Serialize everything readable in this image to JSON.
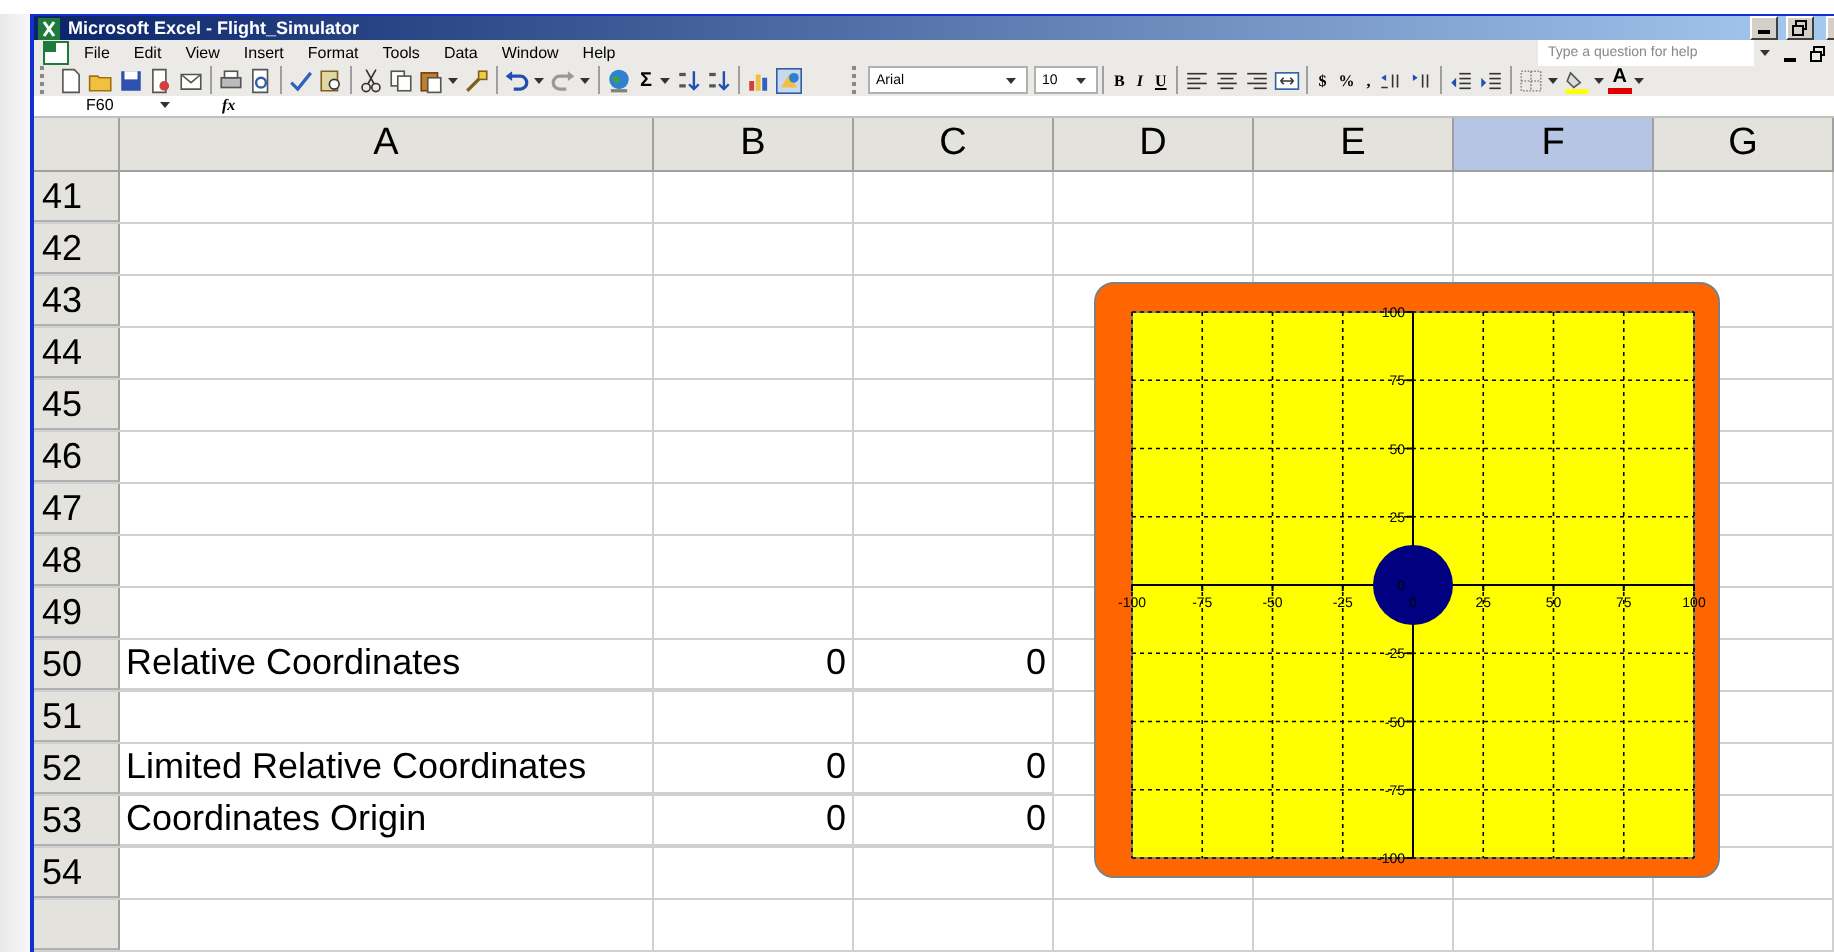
{
  "window": {
    "title": "Microsoft Excel - Flight_Simulator"
  },
  "menu_bar": {
    "items": [
      "File",
      "Edit",
      "View",
      "Insert",
      "Format",
      "Tools",
      "Data",
      "Window",
      "Help"
    ],
    "help_search": {
      "placeholder": "Type a question for help"
    }
  },
  "standard_toolbar": {
    "sum_button": "Σ"
  },
  "formatting_toolbar": {
    "font": "Arial",
    "size": "10",
    "style_buttons": [
      "B",
      "I",
      "U"
    ],
    "number_buttons": [
      "$",
      "%",
      ","
    ],
    "font_color_button": "A"
  },
  "formula_bar": {
    "name_box": "F60",
    "function_label": "fx"
  },
  "sheet": {
    "columns": [
      {
        "label": "A",
        "selected": false
      },
      {
        "label": "B",
        "selected": false
      },
      {
        "label": "C",
        "selected": false
      },
      {
        "label": "D",
        "selected": false
      },
      {
        "label": "E",
        "selected": false
      },
      {
        "label": "F",
        "selected": true
      },
      {
        "label": "G",
        "selected": false
      }
    ],
    "rows": [
      {
        "number": "41"
      },
      {
        "number": "42"
      },
      {
        "number": "43"
      },
      {
        "number": "44"
      },
      {
        "number": "45"
      },
      {
        "number": "46"
      },
      {
        "number": "47"
      },
      {
        "number": "48"
      },
      {
        "number": "49"
      },
      {
        "number": "50",
        "cells": {
          "A": "Relative Coordinates",
          "B": "0",
          "C": "0"
        }
      },
      {
        "number": "51"
      },
      {
        "number": "52",
        "cells": {
          "A": "Limited Relative Coordinates",
          "B": "0",
          "C": "0"
        }
      },
      {
        "number": "53",
        "cells": {
          "A": "Coordinates Origin",
          "B": "0",
          "C": "0"
        }
      },
      {
        "number": "54"
      }
    ],
    "chart": {
      "chart_data": {
        "type": "scatter",
        "x": [
          0
        ],
        "series": [
          {
            "color": "#000080",
            "values": [
              0
            ]
          }
        ],
        "xlim": [
          -100,
          100
        ],
        "ylim": [
          -100,
          100
        ],
        "grid": true,
        "xticks": [
          {
            "value": -100,
            "label": "-100"
          },
          {
            "value": -75,
            "label": "-75"
          },
          {
            "value": -50,
            "label": "-50"
          },
          {
            "value": -25,
            "label": "-25"
          },
          {
            "value": 0,
            "label": "0"
          },
          {
            "value": 25,
            "label": "25"
          },
          {
            "value": 50,
            "label": "50"
          },
          {
            "value": 75,
            "label": "75"
          },
          {
            "value": 100,
            "label": "100"
          }
        ],
        "yticks": [
          {
            "value": -100,
            "label": "-100"
          },
          {
            "value": -75,
            "label": "-75"
          },
          {
            "value": -50,
            "label": "-50"
          },
          {
            "value": -25,
            "label": "-25"
          },
          {
            "value": 0,
            "label": "0"
          },
          {
            "value": 25,
            "label": "25"
          },
          {
            "value": 50,
            "label": "50"
          },
          {
            "value": 75,
            "label": "75"
          },
          {
            "value": 100,
            "label": "100"
          }
        ]
      }
    }
  }
}
